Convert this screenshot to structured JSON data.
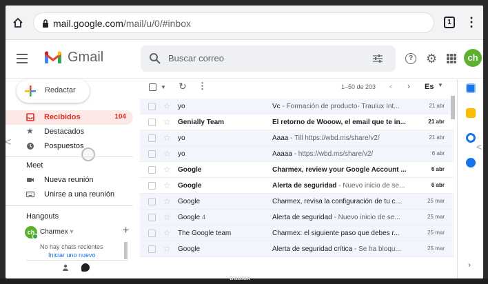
{
  "browser": {
    "url_host": "mail.google.com",
    "url_path": "/mail/u/0/#inbox",
    "tab_count": "1"
  },
  "header": {
    "app_name": "Gmail",
    "search_placeholder": "Buscar correo",
    "avatar_initials": "ch",
    "help_glyph": "?"
  },
  "nav": {
    "compose_label": "Redactar",
    "items": [
      {
        "label": "Recibidos",
        "count": "104"
      },
      {
        "label": "Destacados",
        "count": ""
      },
      {
        "label": "Pospuestos",
        "count": ""
      }
    ],
    "meet_title": "Meet",
    "meet_items": [
      {
        "label": "Nueva reunión"
      },
      {
        "label": "Unirse a una reunión"
      }
    ],
    "hangouts_title": "Hangouts",
    "hangouts_user": "Charmex",
    "no_chats": "No hay chats recientes",
    "start_new": "Iniciar uno nuevo"
  },
  "toolbar": {
    "range": "1–50 de 203",
    "lang": "Es"
  },
  "emails": [
    {
      "sender": "yo",
      "count": "",
      "subject": "Vc",
      "snippet": " - Formación de producto- Traulux Int...",
      "date": "21 abr",
      "unread": false
    },
    {
      "sender": "Genially Team",
      "count": "",
      "subject": "El retorno de Wooow, el email que te in...",
      "snippet": "",
      "date": "21 abr",
      "unread": true
    },
    {
      "sender": "yo",
      "count": "",
      "subject": "Aaaa",
      "snippet": " - Till https://wbd.ms/share/v2/",
      "date": "21 abr",
      "unread": false
    },
    {
      "sender": "yo",
      "count": "",
      "subject": "Aaaaa",
      "snippet": " - https://wbd.ms/share/v2/",
      "date": "6 abr",
      "unread": false
    },
    {
      "sender": "Google",
      "count": "",
      "subject": "Charmex, review your Google Account ...",
      "snippet": "",
      "date": "6 abr",
      "unread": true
    },
    {
      "sender": "Google",
      "count": "",
      "subject": "Alerta de seguridad",
      "snippet": " - Nuevo inicio de se...",
      "date": "6 abr",
      "unread": true
    },
    {
      "sender": "Google",
      "count": "",
      "subject": "Charmex, revisa la configuración de tu c...",
      "snippet": "",
      "date": "25 mar",
      "unread": false
    },
    {
      "sender": "Google",
      "count": "4",
      "subject": "Alerta de seguridad",
      "snippet": " - Nuevo inicio de se...",
      "date": "25 mar",
      "unread": false
    },
    {
      "sender": "The Google team",
      "count": "",
      "subject": "Charmex: el siguiente paso que debes r...",
      "snippet": "",
      "date": "25 mar",
      "unread": false
    },
    {
      "sender": "Google",
      "count": "",
      "subject": "Alerta de seguridad crítica",
      "snippet": " - Se ha bloqu...",
      "date": "25 mar",
      "unread": false
    }
  ],
  "taskbar": {
    "label": "traulux"
  },
  "colors": {
    "accent": "#d93025",
    "avatar": "#5cb230",
    "active_bg": "#fce8e6"
  }
}
